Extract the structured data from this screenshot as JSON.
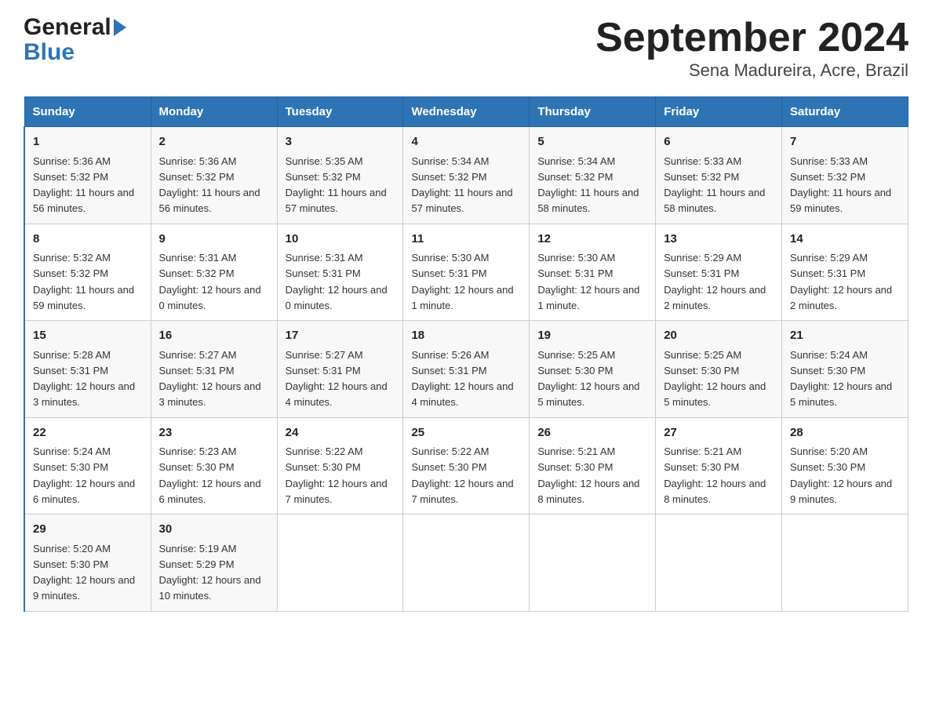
{
  "logo": {
    "line1": "General",
    "line2": "Blue"
  },
  "title": "September 2024",
  "subtitle": "Sena Madureira, Acre, Brazil",
  "days": [
    "Sunday",
    "Monday",
    "Tuesday",
    "Wednesday",
    "Thursday",
    "Friday",
    "Saturday"
  ],
  "weeks": [
    [
      {
        "day": "1",
        "sunrise": "5:36 AM",
        "sunset": "5:32 PM",
        "daylight": "11 hours and 56 minutes."
      },
      {
        "day": "2",
        "sunrise": "5:36 AM",
        "sunset": "5:32 PM",
        "daylight": "11 hours and 56 minutes."
      },
      {
        "day": "3",
        "sunrise": "5:35 AM",
        "sunset": "5:32 PM",
        "daylight": "11 hours and 57 minutes."
      },
      {
        "day": "4",
        "sunrise": "5:34 AM",
        "sunset": "5:32 PM",
        "daylight": "11 hours and 57 minutes."
      },
      {
        "day": "5",
        "sunrise": "5:34 AM",
        "sunset": "5:32 PM",
        "daylight": "11 hours and 58 minutes."
      },
      {
        "day": "6",
        "sunrise": "5:33 AM",
        "sunset": "5:32 PM",
        "daylight": "11 hours and 58 minutes."
      },
      {
        "day": "7",
        "sunrise": "5:33 AM",
        "sunset": "5:32 PM",
        "daylight": "11 hours and 59 minutes."
      }
    ],
    [
      {
        "day": "8",
        "sunrise": "5:32 AM",
        "sunset": "5:32 PM",
        "daylight": "11 hours and 59 minutes."
      },
      {
        "day": "9",
        "sunrise": "5:31 AM",
        "sunset": "5:32 PM",
        "daylight": "12 hours and 0 minutes."
      },
      {
        "day": "10",
        "sunrise": "5:31 AM",
        "sunset": "5:31 PM",
        "daylight": "12 hours and 0 minutes."
      },
      {
        "day": "11",
        "sunrise": "5:30 AM",
        "sunset": "5:31 PM",
        "daylight": "12 hours and 1 minute."
      },
      {
        "day": "12",
        "sunrise": "5:30 AM",
        "sunset": "5:31 PM",
        "daylight": "12 hours and 1 minute."
      },
      {
        "day": "13",
        "sunrise": "5:29 AM",
        "sunset": "5:31 PM",
        "daylight": "12 hours and 2 minutes."
      },
      {
        "day": "14",
        "sunrise": "5:29 AM",
        "sunset": "5:31 PM",
        "daylight": "12 hours and 2 minutes."
      }
    ],
    [
      {
        "day": "15",
        "sunrise": "5:28 AM",
        "sunset": "5:31 PM",
        "daylight": "12 hours and 3 minutes."
      },
      {
        "day": "16",
        "sunrise": "5:27 AM",
        "sunset": "5:31 PM",
        "daylight": "12 hours and 3 minutes."
      },
      {
        "day": "17",
        "sunrise": "5:27 AM",
        "sunset": "5:31 PM",
        "daylight": "12 hours and 4 minutes."
      },
      {
        "day": "18",
        "sunrise": "5:26 AM",
        "sunset": "5:31 PM",
        "daylight": "12 hours and 4 minutes."
      },
      {
        "day": "19",
        "sunrise": "5:25 AM",
        "sunset": "5:30 PM",
        "daylight": "12 hours and 5 minutes."
      },
      {
        "day": "20",
        "sunrise": "5:25 AM",
        "sunset": "5:30 PM",
        "daylight": "12 hours and 5 minutes."
      },
      {
        "day": "21",
        "sunrise": "5:24 AM",
        "sunset": "5:30 PM",
        "daylight": "12 hours and 5 minutes."
      }
    ],
    [
      {
        "day": "22",
        "sunrise": "5:24 AM",
        "sunset": "5:30 PM",
        "daylight": "12 hours and 6 minutes."
      },
      {
        "day": "23",
        "sunrise": "5:23 AM",
        "sunset": "5:30 PM",
        "daylight": "12 hours and 6 minutes."
      },
      {
        "day": "24",
        "sunrise": "5:22 AM",
        "sunset": "5:30 PM",
        "daylight": "12 hours and 7 minutes."
      },
      {
        "day": "25",
        "sunrise": "5:22 AM",
        "sunset": "5:30 PM",
        "daylight": "12 hours and 7 minutes."
      },
      {
        "day": "26",
        "sunrise": "5:21 AM",
        "sunset": "5:30 PM",
        "daylight": "12 hours and 8 minutes."
      },
      {
        "day": "27",
        "sunrise": "5:21 AM",
        "sunset": "5:30 PM",
        "daylight": "12 hours and 8 minutes."
      },
      {
        "day": "28",
        "sunrise": "5:20 AM",
        "sunset": "5:30 PM",
        "daylight": "12 hours and 9 minutes."
      }
    ],
    [
      {
        "day": "29",
        "sunrise": "5:20 AM",
        "sunset": "5:30 PM",
        "daylight": "12 hours and 9 minutes."
      },
      {
        "day": "30",
        "sunrise": "5:19 AM",
        "sunset": "5:29 PM",
        "daylight": "12 hours and 10 minutes."
      },
      null,
      null,
      null,
      null,
      null
    ]
  ],
  "labels": {
    "sunrise": "Sunrise:",
    "sunset": "Sunset:",
    "daylight": "Daylight:"
  }
}
